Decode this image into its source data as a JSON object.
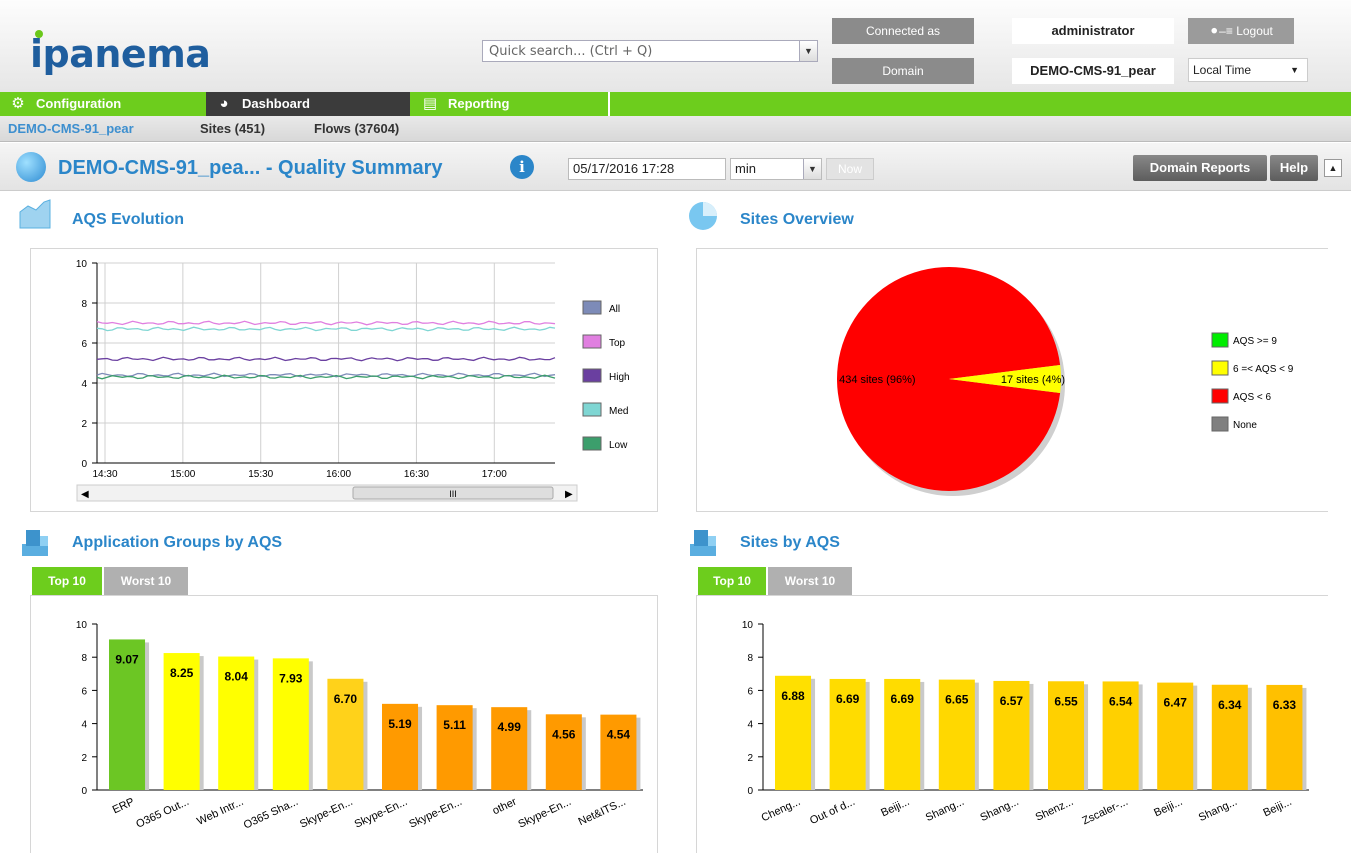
{
  "header": {
    "logo": "ipanema",
    "search_placeholder": "Quick search... (Ctrl + Q)",
    "connected_as_label": "Connected as",
    "connected_as_value": "administrator",
    "domain_label": "Domain",
    "domain_value": "DEMO-CMS-91_pear",
    "logout_label": "Logout",
    "timezone": "Local Time"
  },
  "nav": {
    "configuration": "Configuration",
    "dashboard": "Dashboard",
    "reporting": "Reporting"
  },
  "breadcrumb": {
    "domain": "DEMO-CMS-91_pear",
    "sites": "Sites (451)",
    "flows": "Flows (37604)"
  },
  "titlebar": {
    "title": "DEMO-CMS-91_pea... - Quality Summary",
    "date": "05/17/2016 17:28",
    "unit": "min",
    "now": "Now",
    "domain_reports": "Domain Reports",
    "help": "Help"
  },
  "panels": {
    "aqs_evolution": "AQS Evolution",
    "sites_overview": "Sites Overview",
    "app_groups": "Application Groups by AQS",
    "sites_by_aqs": "Sites by AQS",
    "tab_top": "Top 10",
    "tab_worst": "Worst 10"
  },
  "chart_data": [
    {
      "id": "aqs_evolution",
      "type": "line",
      "x": [
        "14:30",
        "15:00",
        "15:30",
        "16:00",
        "16:30",
        "17:00"
      ],
      "ylim": [
        0,
        10
      ],
      "yticks": [
        0,
        2,
        4,
        6,
        8,
        10
      ],
      "grid": true,
      "legend_position": "right",
      "series": [
        {
          "name": "All",
          "color": "#7d8bb8",
          "level": 4.4
        },
        {
          "name": "Top",
          "color": "#e07fe0",
          "level": 7.0
        },
        {
          "name": "High",
          "color": "#6a3fa0",
          "level": 5.2
        },
        {
          "name": "Med",
          "color": "#7fd6d3",
          "level": 6.7
        },
        {
          "name": "Low",
          "color": "#3c9e6c",
          "level": 4.3
        }
      ],
      "scrollbar_grip": "III"
    },
    {
      "id": "sites_overview",
      "type": "pie",
      "slices": [
        {
          "label": "434 sites (96%)",
          "value": 96,
          "color": "#ff0000"
        },
        {
          "label": "17 sites (4%)",
          "value": 4,
          "color": "#ffff00"
        }
      ],
      "legend": [
        {
          "name": "AQS >= 9",
          "color": "#00ee00"
        },
        {
          "name": "6 =< AQS < 9",
          "color": "#ffff00"
        },
        {
          "name": "AQS < 6",
          "color": "#ff0000"
        },
        {
          "name": "None",
          "color": "#808080"
        }
      ]
    },
    {
      "id": "app_groups",
      "type": "bar",
      "categories": [
        "ERP",
        "O365 Out...",
        "Web Intr...",
        "O365 Sha...",
        "Skype-En...",
        "Skype-En...",
        "Skype-En...",
        "other",
        "Skype-En...",
        "Net&ITS..."
      ],
      "values": [
        9.07,
        8.25,
        8.04,
        7.93,
        6.7,
        5.19,
        5.11,
        4.99,
        4.56,
        4.54
      ],
      "labels": [
        "9.07",
        "8.25",
        "8.04",
        "7.93",
        "6.70",
        "5.19",
        "5.11",
        "4.99",
        "4.56",
        "4.54"
      ],
      "colors": [
        "#6cc624",
        "#ffff00",
        "#ffff00",
        "#ffff00",
        "#ffd21a",
        "#ff9a00",
        "#ff9a00",
        "#ff9a00",
        "#ff9a00",
        "#ff9a00"
      ],
      "ylim": [
        0,
        10
      ],
      "yticks": [
        0,
        2,
        4,
        6,
        8,
        10
      ]
    },
    {
      "id": "sites_by_aqs",
      "type": "bar",
      "categories": [
        "Cheng...",
        "Out of d...",
        "Beiji...",
        "Shang...",
        "Shang...",
        "Shenz...",
        "Zscaler-...",
        "Beiji...",
        "Shang...",
        "Beiji..."
      ],
      "values": [
        6.88,
        6.69,
        6.69,
        6.65,
        6.57,
        6.55,
        6.54,
        6.47,
        6.34,
        6.33
      ],
      "labels": [
        "6.88",
        "6.69",
        "6.69",
        "6.65",
        "6.57",
        "6.55",
        "6.54",
        "6.47",
        "6.34",
        "6.33"
      ],
      "colors": [
        "#ffe000",
        "#ffdc00",
        "#ffdc00",
        "#ffd800",
        "#ffd400",
        "#ffd000",
        "#ffd000",
        "#ffca00",
        "#ffc400",
        "#ffc000"
      ],
      "ylim": [
        0,
        10
      ],
      "yticks": [
        0,
        2,
        4,
        6,
        8,
        10
      ]
    }
  ]
}
